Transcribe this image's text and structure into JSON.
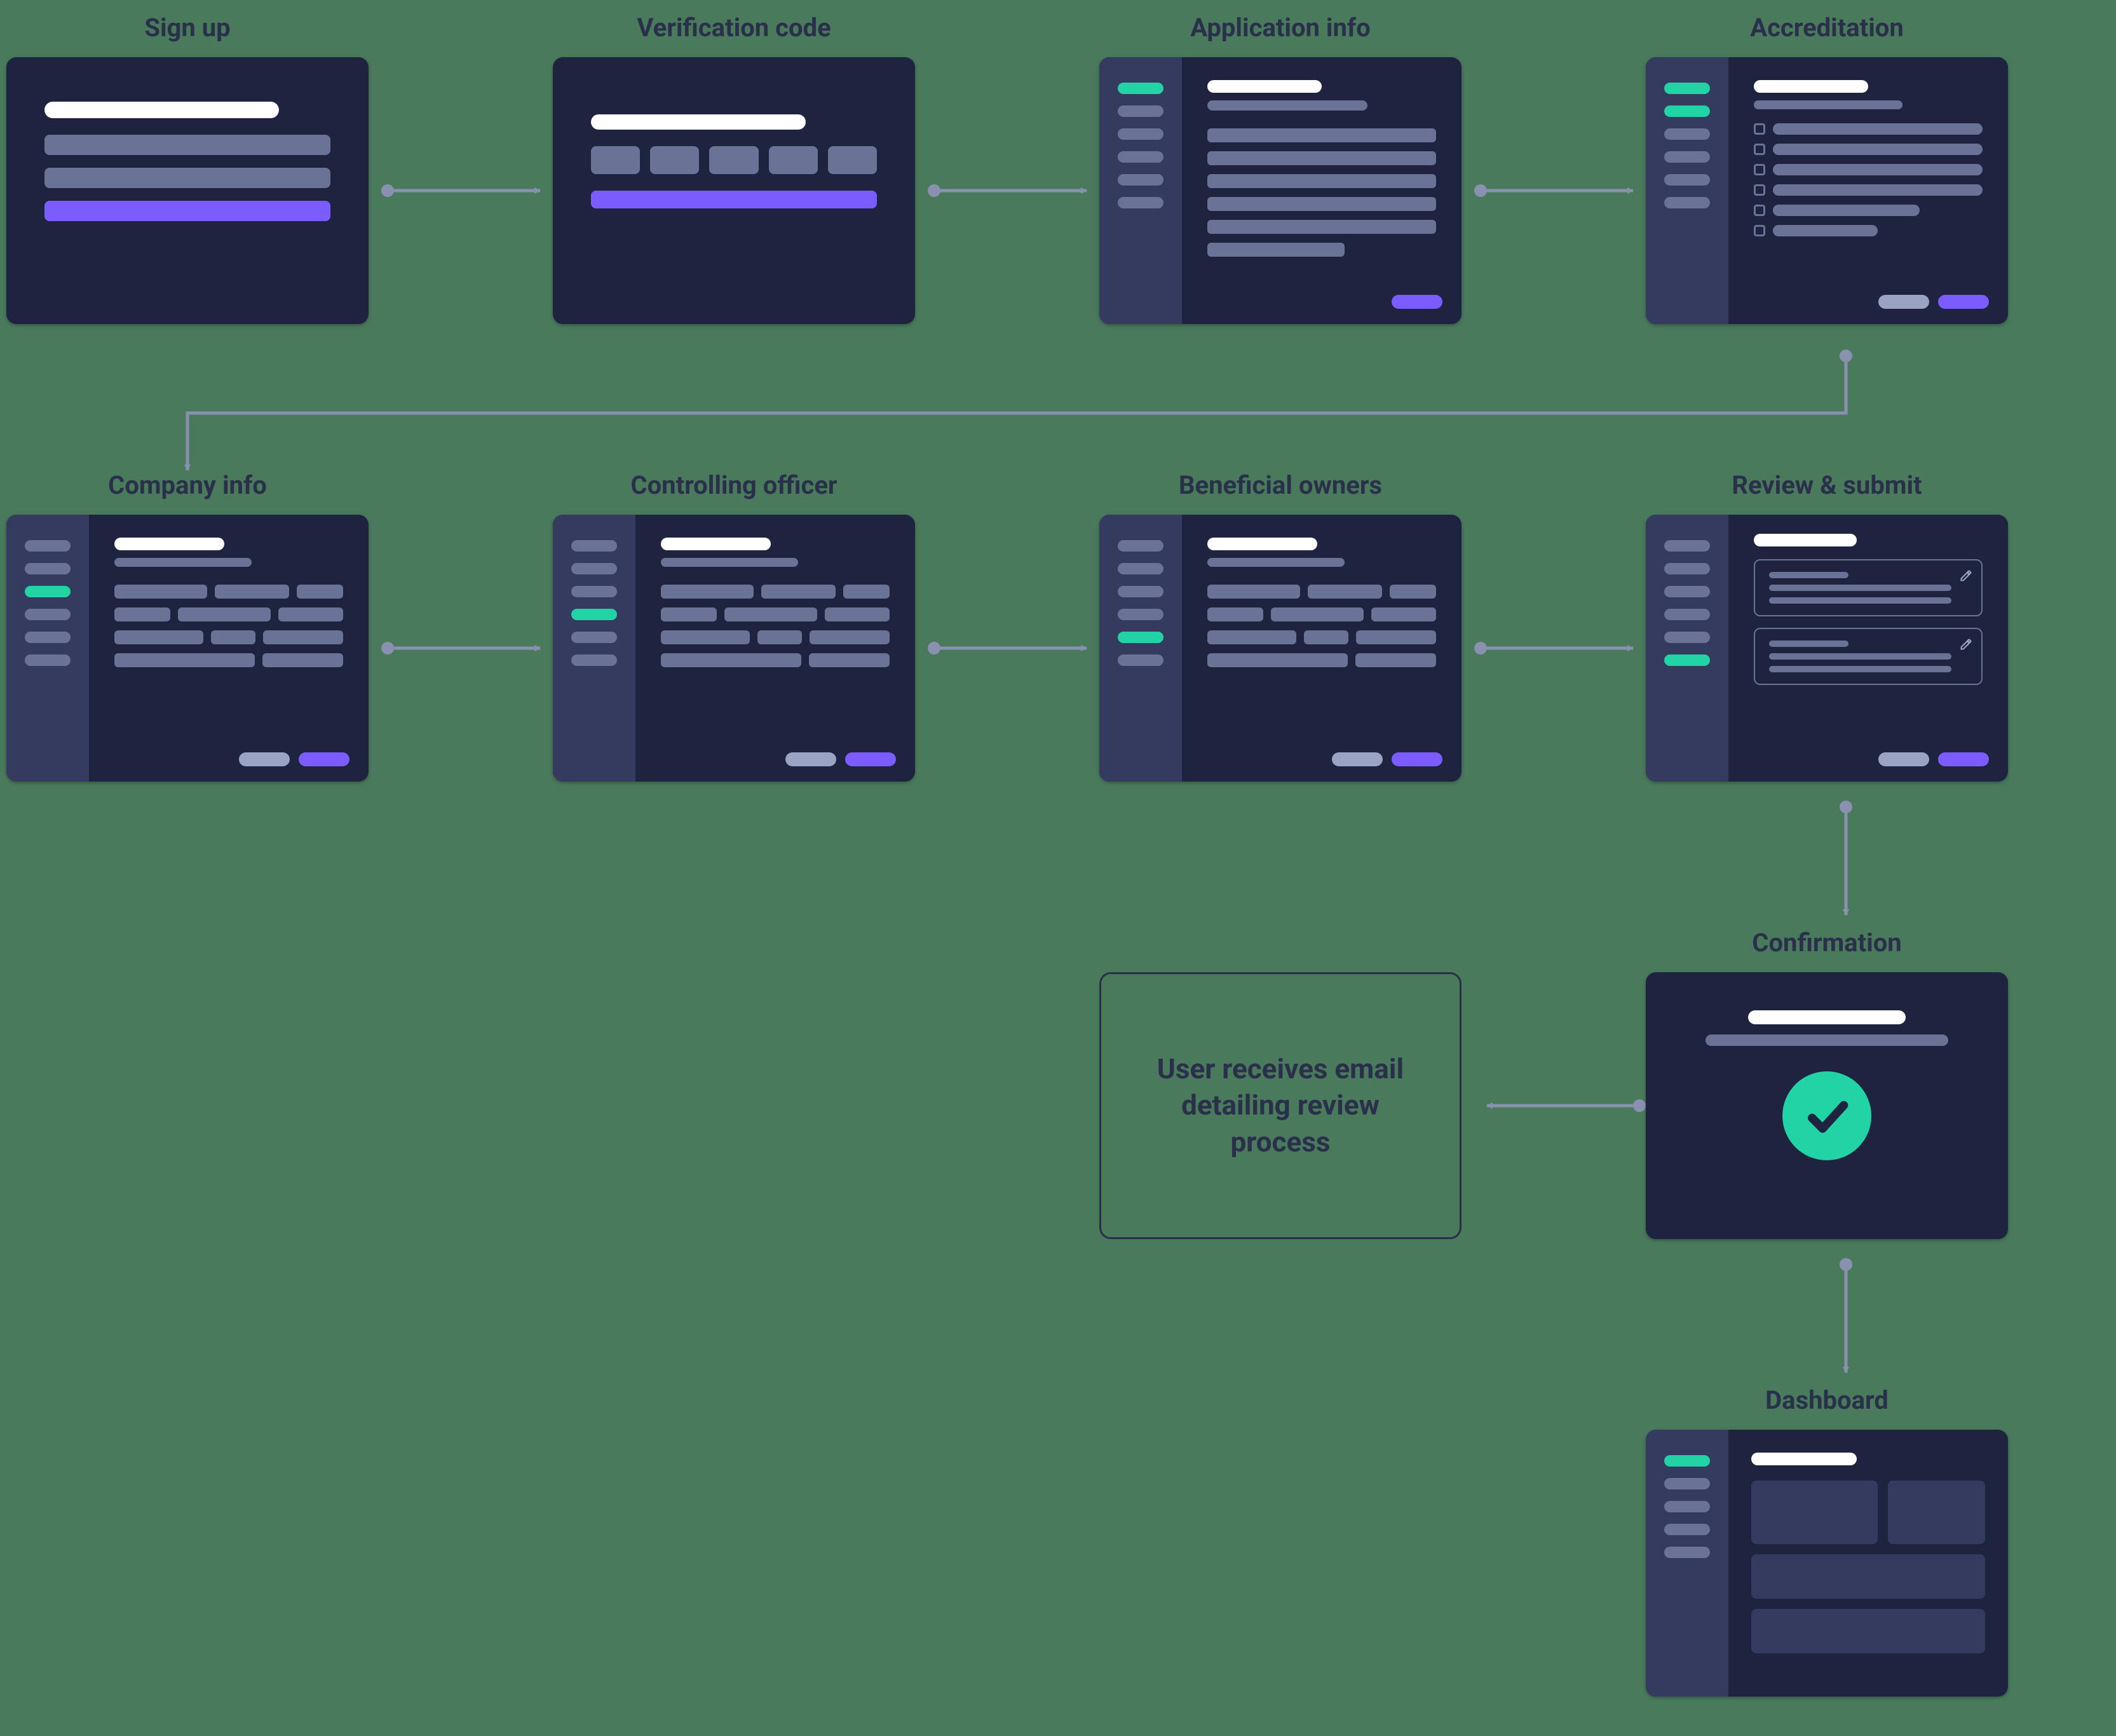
{
  "steps": {
    "signup": "Sign up",
    "verification": "Verification code",
    "app_info": "Application info",
    "accreditation": "Accreditation",
    "company_info": "Company info",
    "controlling_officer": "Controlling officer",
    "beneficial_owners": "Beneficial owners",
    "review_submit": "Review & submit",
    "confirmation": "Confirmation",
    "dashboard": "Dashboard"
  },
  "note": "User receives email detailing review process",
  "colors": {
    "bg": "#4a7a5c",
    "card": "#1e2340",
    "sidebar": "#353b5e",
    "line": "#6a7396",
    "accent_green": "#22d3a5",
    "accent_purple": "#7b5cff",
    "title": "#2a2f4a"
  }
}
